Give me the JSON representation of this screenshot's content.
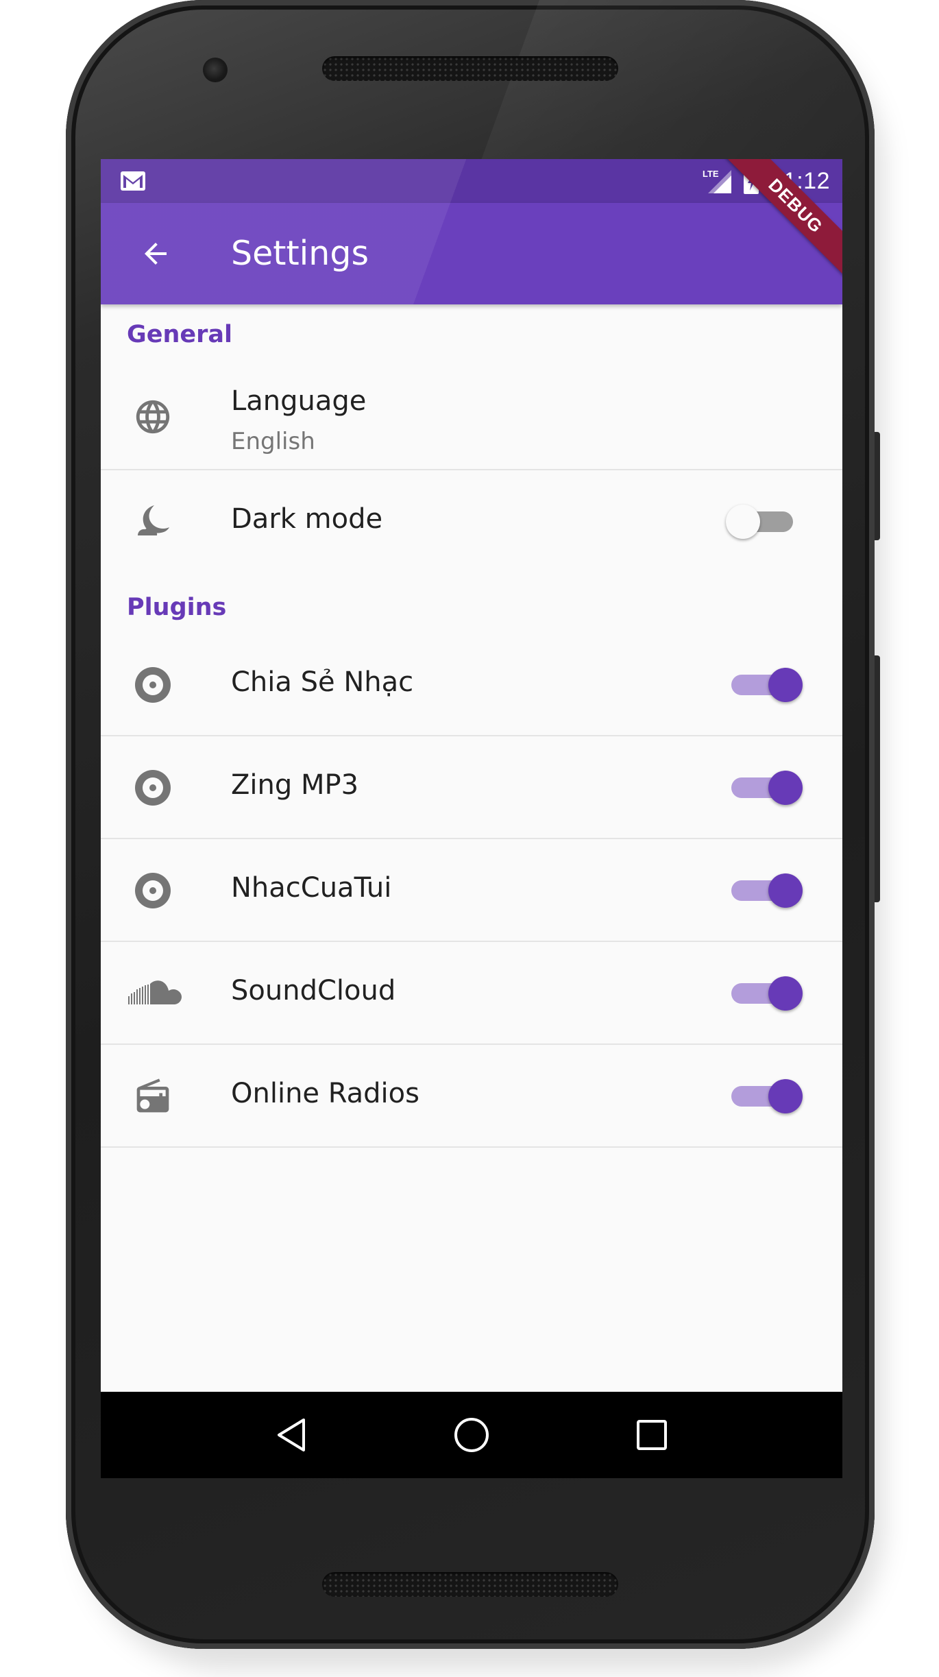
{
  "status_bar": {
    "time": "21:12",
    "network": "LTE",
    "notification_icon": "gmail-icon"
  },
  "app_bar": {
    "title": "Settings",
    "back_icon": "arrow-back-icon",
    "debug_banner": "DEBUG"
  },
  "colors": {
    "primary": "#673ab7",
    "primary_dark": "#5a35a3",
    "switch_track_on": "#b39ddb",
    "switch_track_off": "#9e9e9e",
    "text_primary": "#212121",
    "text_secondary": "#757575",
    "background": "#fafafa"
  },
  "sections": {
    "general": {
      "header": "General",
      "language": {
        "icon": "globe-icon",
        "title": "Language",
        "subtitle": "English"
      },
      "dark_mode": {
        "icon": "moon-icon",
        "title": "Dark mode",
        "enabled": false
      }
    },
    "plugins": {
      "header": "Plugins",
      "items": [
        {
          "icon": "disc-icon",
          "title": "Chia Sẻ Nhạc",
          "enabled": true
        },
        {
          "icon": "disc-icon",
          "title": "Zing MP3",
          "enabled": true
        },
        {
          "icon": "disc-icon",
          "title": "NhacCuaTui",
          "enabled": true
        },
        {
          "icon": "soundcloud-icon",
          "title": "SoundCloud",
          "enabled": true
        },
        {
          "icon": "radio-icon",
          "title": "Online Radios",
          "enabled": true
        }
      ]
    }
  },
  "nav_bar": {
    "back": "nav-back-icon",
    "home": "nav-home-icon",
    "recents": "nav-recents-icon"
  }
}
